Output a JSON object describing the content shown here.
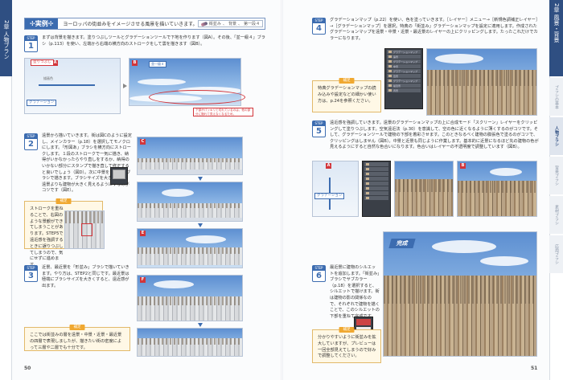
{
  "left_page": {
    "chapter_tab": "2章 人物ブラン",
    "example": {
      "tag": "✢実例✢",
      "text": "ヨーロッパの街並みをイメージさせる風景を描いていきます。",
      "chips": [
        "街並み",
        "背景",
        "第一段４"
      ]
    },
    "step1": {
      "label": "STEP",
      "num": "1",
      "text": "まずは背景を描きます。塗りつぶしツールとグラデーションツールで下地を作ります（図A）。その後、「並一級４」ブラシ（p.113）を使い、左端から右端の横方向のストロークをして雲を描きます（図B）。",
      "callout_labels": [
        "塗りつぶし",
        "描画色",
        "グラデーション"
      ],
      "brush_label": "並一級４",
      "note": "下部がパッキリと切れているのは、他の部分に隠れて見えなくなるため。"
    },
    "step2": {
      "label": "STEP",
      "num": "2",
      "text": "遠景から描いていきます。街は図Cのように設定し、メインカラー（p.18）を選択してモノクロにします。「形図あ」ブラシを横方向にストロークします。１段のストロークで一気に描き、納得がいかなかったらやり直しをするか、納得のいかない部分にスタンプで描き直して修正すると良いでしょう（図D）。次に中景を「並塗」ブラシで描きます。ブラシサイズを大きくして、遠景よりも建物が大きく見えるようにするのがコツです（図E）。"
    },
    "hint1": {
      "title": "補足",
      "text": "ストロークを重ねることで、右図のような景観ができてしまうことがあります。STEP5で遠近感を強調するときに誤りつぶしてしまうので、気にせずに進めます。"
    },
    "step3": {
      "label": "STEP",
      "num": "3",
      "text": "近景、最近景を「形並み」ブラシで描いていきます。やり方は、STEP2と同じです。最近景は極端にブラシサイズを大きくすると、遠近感が出ます。"
    },
    "hint2": {
      "title": "補足",
      "text": "ここでは街並みの層を遠景・中景・近景・最近景の四層で表現しましたが、描きたい街の密度によって三層や二層でも十分です。"
    },
    "figure_tags": [
      "A",
      "B",
      "C",
      "D",
      "E",
      "F"
    ],
    "page_number": "50"
  },
  "right_page": {
    "chapter_tab": "2章 風景・背景",
    "side_tabs": [
      "ブラシの基本",
      "人物ブラシ",
      "背景ブラシ",
      "素材ブラシ",
      "応用ブラシ"
    ],
    "active_tab_index": 1,
    "step4": {
      "label": "STEP",
      "num": "4",
      "text": "グラデーションマップ（p.22）を使い、色を塗っていきます。［レイヤー］メニュー→［新規色調補正レイヤー］→［グラデーションマップ］を選択。特典の「街並み」グラデーションマップを設定に適用します。作成されたグラデーションマップを遠景・中景・近景・最近景のレイヤーの上にクリッピングします。たったこれだけでカラーになります。"
    },
    "hint3": {
      "title": "補足",
      "text": "特典グラデーションマップの読み込みや設定などの細かい使い方は、p.24を参照ください。"
    },
    "step5": {
      "label": "STEP",
      "num": "5",
      "text": "遠近感を強調していきます。遠景のグラデーションマップの上に合成モード「スクリーン」レイヤーをクリッピングして塗りつぶします。空気遠近法（p.30）を意識して、空の色に近くなるように薄くするのがコツです。そして、グラデーションツールで建物の下部を着彩させます。このときなるべく建物の膨張色で塗るのがコツで、クリッピングはしません（図B）。中景と近景も同じように作業します。基本的に近景になるほど先の建物の色が見えるようにすると自然な色合いになります。色合いはレイヤーの不透明度で調整しています（図B）。",
      "callout_label": "グラデーション"
    },
    "step6": {
      "label": "STEP",
      "num": "6",
      "text": "最近景に建物のシルエットを追加します。「街並み」ブラシでサブカラー（p.18）を選択すると、シルエットで描けます。街は建物の影の関係なので、それぞれで建物を描くことで、このシルエットの下部を重ねて完成です。",
      "banner": "完成"
    },
    "hint4": {
      "title": "補足",
      "text": "分かりやすいように街並みを拡大していますが、プレビューは一回全部見えてしまうので好みで調整してください。"
    },
    "layer_names": [
      "グラデーションマップ",
      "遠景",
      "中景",
      "近景",
      "最近景",
      "背景"
    ],
    "figure_tags": [
      "A",
      "B"
    ],
    "page_number": "51"
  },
  "colors": {
    "accent_blue": "#3c6cb0",
    "highlight_red": "#d2353a",
    "hint_orange": "#f0a830",
    "chapter_navy": "#2f4f82"
  }
}
